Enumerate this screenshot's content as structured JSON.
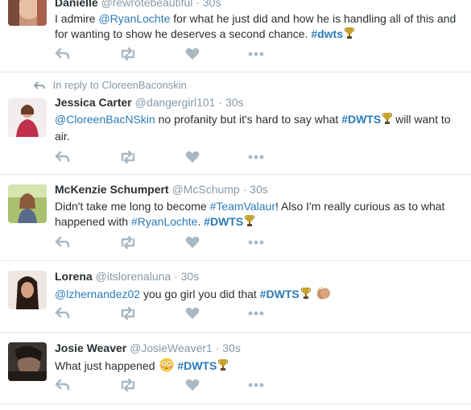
{
  "tweets": [
    {
      "name": "Danielle",
      "handle": "@rewrotebeautiful",
      "time": "30s",
      "dot": "·",
      "segments": [
        {
          "t": "I admire "
        },
        {
          "t": "@RyanLochte",
          "c": "link"
        },
        {
          "t": " for what he just did and how he is handling all of this and for wanting to show he deserves a second chance. "
        },
        {
          "t": "#dwts",
          "c": "hash"
        },
        {
          "trophy": true
        }
      ]
    },
    {
      "reply_to": "In reply to CloreenBaconskin",
      "name": "Jessica Carter",
      "handle": "@dangergirl101",
      "time": "30s",
      "dot": "·",
      "segments": [
        {
          "t": "@CloreenBacNSkin",
          "c": "link"
        },
        {
          "t": " no profanity but it's hard to say what "
        },
        {
          "t": "#DWTS",
          "c": "hash"
        },
        {
          "trophy": true
        },
        {
          "t": " will want to air."
        }
      ]
    },
    {
      "name": "McKenzie Schumpert",
      "handle": "@McSchump",
      "time": "30s",
      "dot": "·",
      "segments": [
        {
          "t": "Didn't take me long to become "
        },
        {
          "t": "#TeamValaur",
          "c": "link"
        },
        {
          "t": "! Also I'm really curious as to what happened with "
        },
        {
          "t": "#RyanLochte",
          "c": "link"
        },
        {
          "t": ". "
        },
        {
          "t": "#DWTS",
          "c": "hash"
        },
        {
          "trophy": true
        }
      ]
    },
    {
      "name": "Lorena",
      "handle": "@itslorenaluna",
      "time": "30s",
      "dot": "·",
      "segments": [
        {
          "t": "@lzhernandez02",
          "c": "link"
        },
        {
          "t": " you go girl you did that "
        },
        {
          "t": "#DWTS",
          "c": "hash"
        },
        {
          "trophy": true
        },
        {
          "t": " "
        },
        {
          "emoji": "clap"
        }
      ]
    },
    {
      "name": "Josie Weaver",
      "handle": "@JosieWeaver1",
      "time": "30s",
      "dot": "·",
      "segments": [
        {
          "t": "What just happened "
        },
        {
          "emoji": "flushed"
        },
        {
          "t": " "
        },
        {
          "t": "#DWTS",
          "c": "hash"
        },
        {
          "trophy": true
        }
      ]
    }
  ],
  "icons": {
    "reply": "reply-icon",
    "retweet": "retweet-icon",
    "like": "heart-icon",
    "more": "more-icon",
    "reply_arrow": "reply-arrow-icon",
    "trophy": "trophy-icon"
  },
  "colors": {
    "link": "#2b7bb9",
    "muted": "#8899a6",
    "icon": "#aab8c2",
    "border": "#e1e8ed",
    "text": "#292f33"
  }
}
